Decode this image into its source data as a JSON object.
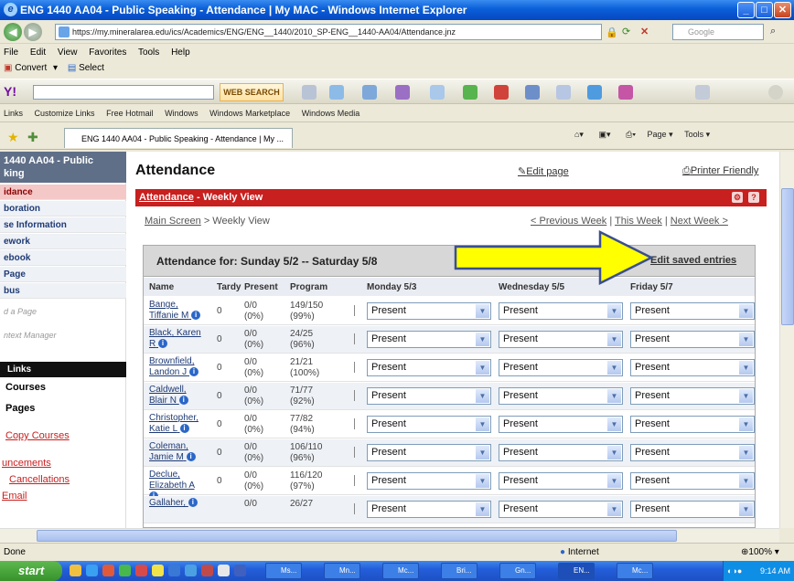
{
  "window": {
    "title": "ENG 1440 AA04 - Public Speaking - Attendance | My MAC - Windows Internet Explorer"
  },
  "address": {
    "url": "https://my.mineralarea.edu/ics/Academics/ENG/ENG__1440/2010_SP-ENG__1440-AA04/Attendance.jnz",
    "search_placeholder": "Google"
  },
  "menu": [
    "File",
    "Edit",
    "View",
    "Favorites",
    "Tools",
    "Help"
  ],
  "convert_bar": {
    "convert": "Convert",
    "select": "Select"
  },
  "toolbar": {
    "web_search": "WEB SEARCH"
  },
  "links_bar": [
    "Links",
    "Customize Links",
    "Free Hotmail",
    "Windows",
    "Windows Marketplace",
    "Windows Media"
  ],
  "tab": {
    "label": "ENG 1440 AA04 - Public Speaking - Attendance | My ..."
  },
  "commands": {
    "page": "Page",
    "tools": "Tools"
  },
  "sidebar": {
    "header": "1440 AA04 - Public\nking",
    "items": [
      {
        "label": "idance",
        "active": true
      },
      {
        "label": "boration",
        "active": false
      },
      {
        "label": "se Information",
        "active": false
      },
      {
        "label": "ework",
        "active": false
      },
      {
        "label": "ebook",
        "active": false
      },
      {
        "label": "Page",
        "active": false
      },
      {
        "label": "bus",
        "active": false
      }
    ],
    "add_page": "d a Page",
    "context_manager": "ntext Manager",
    "links_header": "Links",
    "courses": "Courses",
    "pages": "Pages",
    "copy_courses": "Copy Courses",
    "announcements": "uncements",
    "cancellations": "Cancellations",
    "email": "Email"
  },
  "main": {
    "title": "Attendance",
    "edit_page": "Edit page",
    "printer_friendly": "Printer Friendly",
    "bar_link": "Attendance",
    "bar_rest": " - Weekly View",
    "crumb_link": "Main Screen",
    "crumb_rest": " > Weekly View",
    "prev_week": "< Previous Week",
    "this_week": "This Week",
    "next_week": "Next Week >",
    "attendance_for": "Attendance for: Sunday 5/2 -- Saturday 5/8",
    "edit_saved": "Edit saved entries",
    "columns": [
      "Name",
      "Tardy",
      "Present",
      "Program",
      "Monday 5/3",
      "Wednesday 5/5",
      "Friday 5/7"
    ]
  },
  "students": [
    {
      "name": "Bange, Tiffanie M",
      "tardy": "0",
      "present": "0/0",
      "present_pct": "(0%)",
      "program": "149/150",
      "program_pct": "(99%)",
      "mon": "Present",
      "wed": "Present",
      "fri": "Present"
    },
    {
      "name": "Black, Karen R",
      "tardy": "0",
      "present": "0/0",
      "present_pct": "(0%)",
      "program": "24/25",
      "program_pct": "(96%)",
      "mon": "Present",
      "wed": "Present",
      "fri": "Present"
    },
    {
      "name": "Brownfield, Landon J",
      "tardy": "0",
      "present": "0/0",
      "present_pct": "(0%)",
      "program": "21/21",
      "program_pct": "(100%)",
      "mon": "Present",
      "wed": "Present",
      "fri": "Present"
    },
    {
      "name": "Caldwell, Blair N",
      "tardy": "0",
      "present": "0/0",
      "present_pct": "(0%)",
      "program": "71/77",
      "program_pct": "(92%)",
      "mon": "Present",
      "wed": "Present",
      "fri": "Present"
    },
    {
      "name": "Christopher, Katie L",
      "tardy": "0",
      "present": "0/0",
      "present_pct": "(0%)",
      "program": "77/82",
      "program_pct": "(94%)",
      "mon": "Present",
      "wed": "Present",
      "fri": "Present"
    },
    {
      "name": "Coleman, Jamie M",
      "tardy": "0",
      "present": "0/0",
      "present_pct": "(0%)",
      "program": "106/110",
      "program_pct": "(96%)",
      "mon": "Present",
      "wed": "Present",
      "fri": "Present"
    },
    {
      "name": "Declue, Elizabeth A",
      "tardy": "0",
      "present": "0/0",
      "present_pct": "(0%)",
      "program": "116/120",
      "program_pct": "(97%)",
      "mon": "Present",
      "wed": "Present",
      "fri": "Present"
    },
    {
      "name": "Gallaher,",
      "tardy": "",
      "present": "0/0",
      "present_pct": "",
      "program": "26/27",
      "program_pct": "",
      "mon": "Present",
      "wed": "Present",
      "fri": "Present"
    }
  ],
  "status": {
    "left": "Done",
    "zone": "Internet",
    "zoom": "100%"
  },
  "taskbar": {
    "start": "start",
    "tasks": [
      "Ms...",
      "Mn...",
      "Mc...",
      "Bri...",
      "Gn...",
      "EN...",
      "Mc..."
    ],
    "clock": "9:14 AM"
  },
  "colors": {
    "red_bar": "#c81f1f",
    "arrow": "#ffff00",
    "arrow_outline": "#3b4f8f"
  }
}
